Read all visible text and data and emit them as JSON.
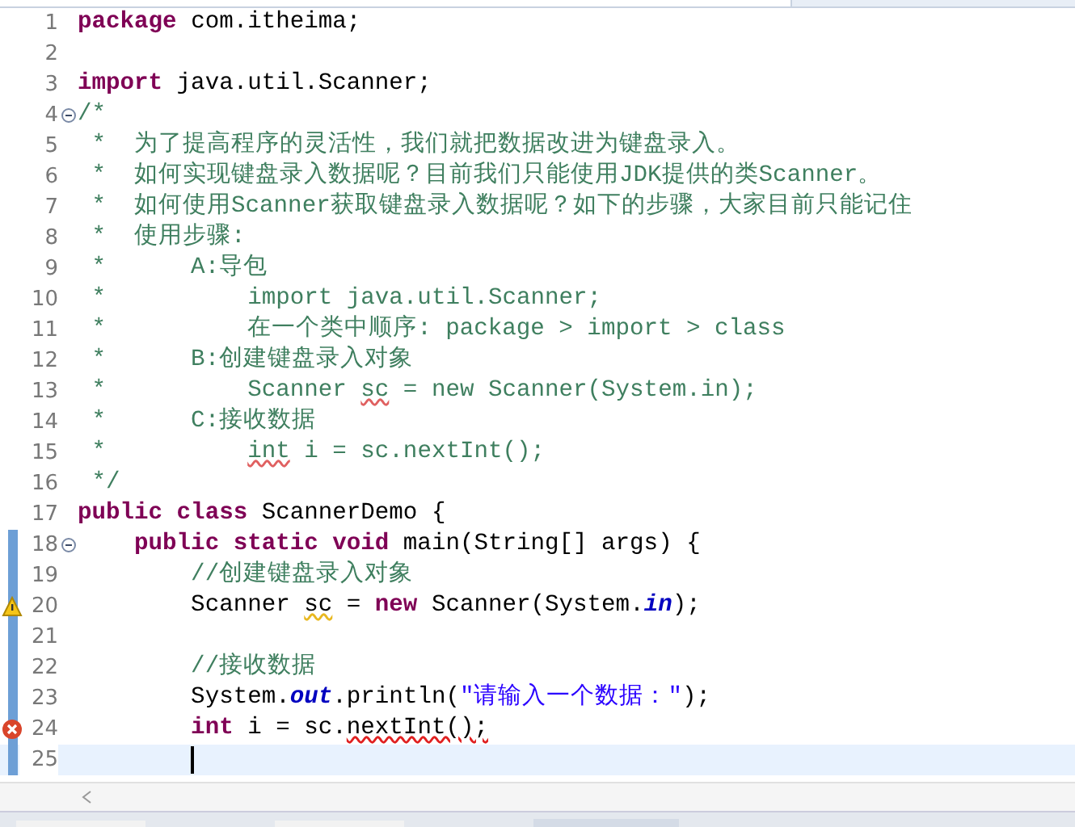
{
  "lines": [
    {
      "number": "1",
      "current": false,
      "tokens": [
        {
          "kind": "keyword",
          "text": "package"
        },
        {
          "kind": "plain",
          "text": " com.itheima;"
        }
      ]
    },
    {
      "number": "2",
      "current": false
    },
    {
      "number": "3",
      "current": false,
      "tokens": [
        {
          "kind": "keyword",
          "text": "import"
        },
        {
          "kind": "plain",
          "text": " java.util.Scanner;"
        }
      ]
    },
    {
      "number": "4",
      "current": false,
      "expanded": true,
      "tokens": [
        {
          "kind": "comment",
          "text": "/*"
        }
      ]
    },
    {
      "number": "5",
      "current": false,
      "tokens": [
        {
          "kind": "comment",
          "text": " *  为了提高程序的灵活性，我们就把数据改进为键盘录入。"
        }
      ]
    },
    {
      "number": "6",
      "current": false,
      "tokens": [
        {
          "kind": "comment",
          "text": " *  如何实现键盘录入数据呢？目前我们只能使用JDK提供的类Scanner。"
        }
      ]
    },
    {
      "number": "7",
      "current": false,
      "tokens": [
        {
          "kind": "comment",
          "text": " *  如何使用Scanner获取键盘录入数据呢？如下的步骤，大家目前只能记住"
        }
      ]
    },
    {
      "number": "8",
      "current": false,
      "tokens": [
        {
          "kind": "comment",
          "text": " *  使用步骤:"
        }
      ]
    },
    {
      "number": "9",
      "current": false,
      "tokens": [
        {
          "kind": "comment",
          "text": " *      A:导包"
        }
      ]
    },
    {
      "number": "10",
      "current": false,
      "tokens": [
        {
          "kind": "comment",
          "text": " *          import java.util.Scanner;"
        }
      ]
    },
    {
      "number": "11",
      "current": false,
      "tokens": [
        {
          "kind": "comment",
          "text": " *          在一个类中顺序: package > import > class"
        }
      ]
    },
    {
      "number": "12",
      "current": false,
      "tokens": [
        {
          "kind": "comment",
          "text": " *      B:创建键盘录入对象"
        }
      ]
    },
    {
      "number": "13",
      "current": false,
      "tokens": [
        {
          "kind": "comment",
          "text": " *          Scanner "
        },
        {
          "kind": "comment",
          "text": "sc",
          "misspelled": true
        },
        {
          "kind": "comment",
          "text": " = new Scanner(System.in);"
        }
      ]
    },
    {
      "number": "14",
      "current": false,
      "tokens": [
        {
          "kind": "comment",
          "text": " *      C:接收数据"
        }
      ]
    },
    {
      "number": "15",
      "current": false,
      "tokens": [
        {
          "kind": "comment",
          "text": " *          "
        },
        {
          "kind": "comment",
          "text": "int",
          "misspelled": true
        },
        {
          "kind": "comment",
          "text": " i = sc.nextInt();"
        }
      ]
    },
    {
      "number": "16",
      "current": false,
      "tokens": [
        {
          "kind": "comment",
          "text": " */"
        }
      ]
    },
    {
      "number": "17",
      "current": false,
      "tokens": [
        {
          "kind": "keyword",
          "text": "public class"
        },
        {
          "kind": "plain",
          "text": " ScannerDemo {"
        }
      ]
    },
    {
      "number": "18",
      "current": false,
      "changed": true,
      "expanded": true,
      "tokens": [
        {
          "kind": "keyword",
          "text": "    public static void"
        },
        {
          "kind": "plain",
          "text": " main(String[] args) {"
        }
      ]
    },
    {
      "number": "19",
      "current": false,
      "changed": true,
      "tokens": [
        {
          "kind": "comment",
          "text": "        //创建键盘录入对象"
        }
      ]
    },
    {
      "number": "20",
      "current": false,
      "changed": true,
      "warning": true,
      "tokens": [
        {
          "kind": "plain",
          "text": "        Scanner "
        },
        {
          "kind": "plain",
          "text": "sc",
          "warning": true
        },
        {
          "kind": "plain",
          "text": " = "
        },
        {
          "kind": "keyword",
          "text": "new"
        },
        {
          "kind": "plain",
          "text": " Scanner(System."
        },
        {
          "kind": "field",
          "text": "in"
        },
        {
          "kind": "plain",
          "text": ");"
        }
      ]
    },
    {
      "number": "21",
      "current": false,
      "changed": true
    },
    {
      "number": "22",
      "current": false,
      "changed": true,
      "tokens": [
        {
          "kind": "comment",
          "text": "        //接收数据"
        }
      ]
    },
    {
      "number": "23",
      "current": false,
      "changed": true,
      "tokens": [
        {
          "kind": "plain",
          "text": "        System."
        },
        {
          "kind": "field",
          "text": "out"
        },
        {
          "kind": "plain",
          "text": ".println("
        },
        {
          "kind": "string",
          "text": "\"请输入一个数据：\""
        },
        {
          "kind": "plain",
          "text": ");"
        }
      ]
    },
    {
      "number": "24",
      "current": false,
      "changed": true,
      "error": true,
      "tokens": [
        {
          "kind": "keyword",
          "text": "        int"
        },
        {
          "kind": "plain",
          "text": " i = sc."
        },
        {
          "kind": "plain",
          "text": "nextInt();",
          "error": true
        }
      ]
    },
    {
      "number": "25",
      "current": true,
      "changed": true
    }
  ]
}
